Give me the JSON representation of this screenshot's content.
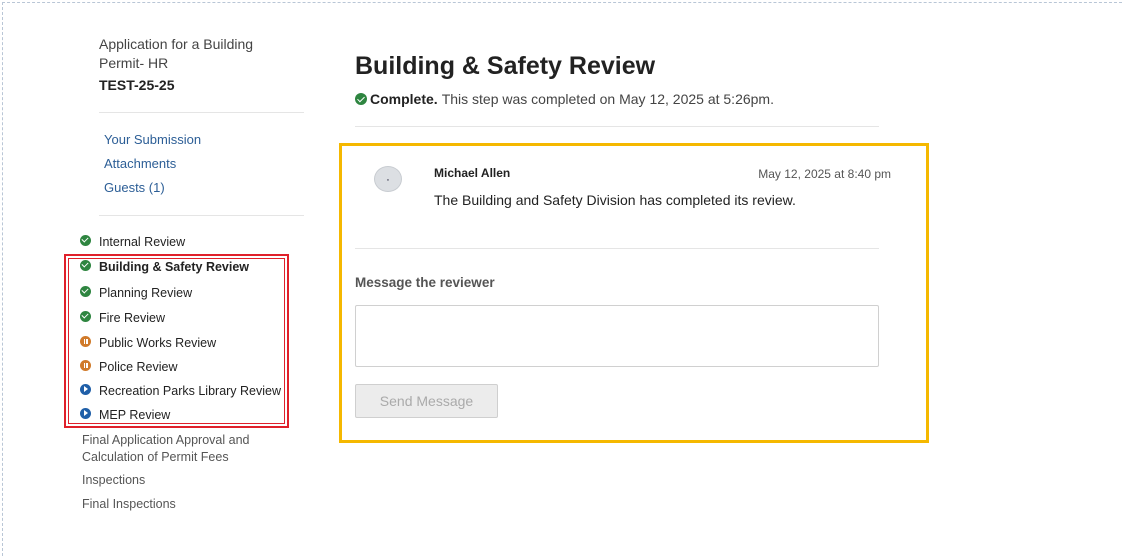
{
  "sidebar": {
    "application_title": "Application for a Building Permit- HR",
    "record_id": "TEST-25-25",
    "links": [
      {
        "label": "Your Submission"
      },
      {
        "label": "Attachments"
      },
      {
        "label": "Guests (1)"
      }
    ],
    "steps": [
      {
        "label": "Internal Review",
        "status": "complete"
      },
      {
        "label": "Building & Safety Review",
        "status": "complete"
      },
      {
        "label": "Planning Review",
        "status": "complete"
      },
      {
        "label": "Fire Review",
        "status": "complete"
      },
      {
        "label": "Public Works Review",
        "status": "paused"
      },
      {
        "label": "Police Review",
        "status": "paused"
      },
      {
        "label": "Recreation Parks Library Review",
        "status": "in-progress"
      },
      {
        "label": "MEP Review",
        "status": "in-progress"
      }
    ],
    "later_steps": [
      {
        "label": "Final Application Approval and Calculation of Permit Fees"
      },
      {
        "label": "Inspections"
      },
      {
        "label": "Final Inspections"
      }
    ]
  },
  "main": {
    "title": "Building & Safety Review",
    "status_label": "Complete.",
    "status_text": "This step was completed on May 12, 2025 at 5:26pm.",
    "comment": {
      "author": "Michael Allen",
      "timestamp": "May 12, 2025 at 8:40 pm",
      "text": "The Building and Safety Division has completed its review."
    },
    "message_label": "Message the reviewer",
    "message_placeholder": "",
    "send_button": "Send Message"
  },
  "colors": {
    "link": "#2c5e96",
    "complete_icon": "#2e8540",
    "paused_icon": "#d07a2a",
    "in_progress_icon": "#1f5fa8",
    "highlight_red": "#e0202a",
    "highlight_yellow": "#f5b800"
  },
  "icons": {
    "complete": "check-circle-icon",
    "paused": "pause-circle-icon",
    "in_progress": "play-circle-icon"
  }
}
